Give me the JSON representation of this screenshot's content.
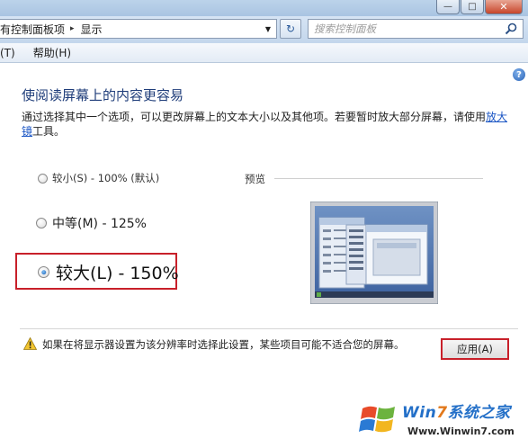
{
  "window": {
    "minimize_glyph": "—",
    "maximize_glyph": "□",
    "close_glyph": "✕"
  },
  "address": {
    "crumb_parent": "有控制面板项",
    "crumb_separator": "▸",
    "crumb_current": "显示",
    "dropdown_glyph": "▼",
    "refresh_glyph": "↻"
  },
  "search": {
    "placeholder": "搜索控制面板",
    "icon": "search-icon"
  },
  "menu": {
    "items": [
      "(T)",
      "帮助(H)"
    ]
  },
  "help_icon": "?",
  "page": {
    "title": "使阅读屏幕上的内容更容易",
    "description": "通过选择其中一个选项，可以更改屏幕上的文本大小以及其他项。若要暂时放大部分屏幕，请使用",
    "magnifier_link": "放大镜",
    "description_suffix": "工具。"
  },
  "options": {
    "small": "较小(S) - 100% (默认)",
    "medium": "中等(M) - 125%",
    "large": "较大(L) - 150%",
    "selected": "large"
  },
  "preview": {
    "label": "预览"
  },
  "warning": {
    "icon": "warning-icon",
    "text": "如果在将显示器设置为该分辨率时选择此设置，某些项目可能不适合您的屏幕。"
  },
  "apply_button": {
    "label": "应用(A)"
  },
  "watermark": {
    "brand_a": "Win",
    "brand_b": "7",
    "brand_c": "系统之家",
    "url": "Www.Winwin7.com"
  },
  "colors": {
    "highlight_border": "#c8202a",
    "title_text": "#1f3d7a",
    "link": "#1a55c4"
  }
}
